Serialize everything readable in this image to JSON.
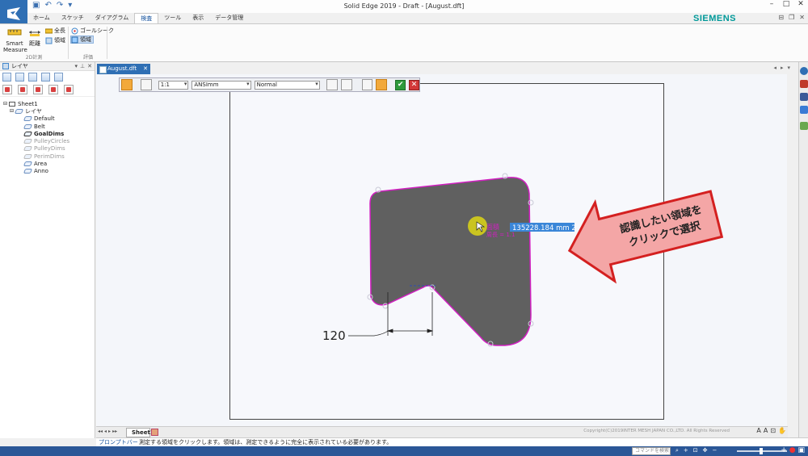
{
  "window": {
    "title": "Solid Edge 2019 - Draft - [August.dft]",
    "brand": "SIEMENS"
  },
  "ribbon": {
    "tabs": [
      "ホーム",
      "スケッチ",
      "ダイアグラム",
      "検査",
      "ツール",
      "表示",
      "データ管理"
    ],
    "active_tab": "検査",
    "smart_measure_label": "Smart\nMeasure",
    "distance_label": "距離",
    "full_length_label": "全長",
    "area_label": "領域",
    "goal_seek_label": "ゴールシーク",
    "area_eval_label": "領域",
    "group_2d": "2D計測",
    "group_eval": "評価"
  },
  "layer_panel": {
    "title": "レイヤ",
    "tree": [
      {
        "label": "Sheet1",
        "level": 0,
        "style": "normal"
      },
      {
        "label": "レイヤ",
        "level": 1,
        "style": "normal"
      },
      {
        "label": "Default",
        "level": 2,
        "style": "normal"
      },
      {
        "label": "Belt",
        "level": 2,
        "style": "normal"
      },
      {
        "label": "GoalDims",
        "level": 2,
        "style": "bold"
      },
      {
        "label": "PulleyCircles",
        "level": 2,
        "style": "dim"
      },
      {
        "label": "PulleyDims",
        "level": 2,
        "style": "dim"
      },
      {
        "label": "PerimDims",
        "level": 2,
        "style": "dim"
      },
      {
        "label": "Area",
        "level": 2,
        "style": "normal"
      },
      {
        "label": "Anno",
        "level": 2,
        "style": "normal"
      }
    ]
  },
  "document": {
    "tab_label": "August.dft",
    "sheet_tab": "Sheet1"
  },
  "command_bar": {
    "scale": "1:1",
    "standard": "ANSImm",
    "style": "Normal"
  },
  "drawing": {
    "dimension_label": "120",
    "area_readout": "135228.184 mm 2",
    "fill_color": "#606060",
    "outline_color": "#d020c0"
  },
  "callout": {
    "line1": "認識したい領域を",
    "line2": "クリックで選択",
    "fill": "#f4a6a6",
    "border": "#d42020"
  },
  "prompt": {
    "label": "プロンプトバー",
    "text": "測定する領域をクリックします。領域は、測定できるように完全に表示されている必要があります。"
  },
  "status": {
    "copyright": "Copyright(C)2019INTER MESH JAPAN CO.,LTD. All Rights Reserved",
    "command_search_placeholder": "コマンドを検索"
  }
}
